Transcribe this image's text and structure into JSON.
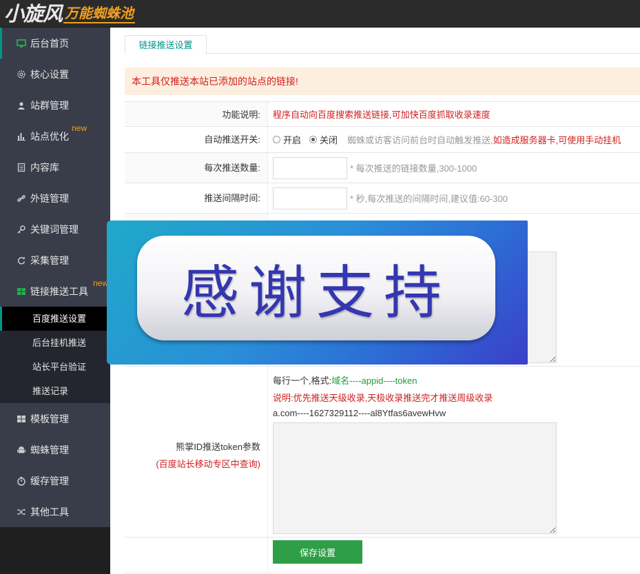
{
  "logo": {
    "main": "小旋风",
    "sub": "万能蜘蛛池"
  },
  "sidebar": {
    "items": [
      {
        "label": "后台首页",
        "icon": "monitor-icon"
      },
      {
        "label": "核心设置",
        "icon": "gear-icon"
      },
      {
        "label": "站群管理",
        "icon": "user-icon"
      },
      {
        "label": "站点优化",
        "icon": "bar-chart-icon",
        "badge": "new"
      },
      {
        "label": "内容库",
        "icon": "document-icon"
      },
      {
        "label": "外链管理",
        "icon": "link-icon"
      },
      {
        "label": "关键词管理",
        "icon": "key-icon"
      },
      {
        "label": "采集管理",
        "icon": "refresh-icon"
      },
      {
        "label": "链接推送工具",
        "icon": "windows-icon",
        "badge": "new"
      }
    ],
    "sub_items": [
      "百度推送设置",
      "后台挂机推送",
      "站长平台验证",
      "推送记录"
    ],
    "items_after": [
      {
        "label": "模板管理",
        "icon": "windows-icon"
      },
      {
        "label": "蜘蛛管理",
        "icon": "android-icon"
      },
      {
        "label": "缓存管理",
        "icon": "timer-icon"
      },
      {
        "label": "其他工具",
        "icon": "shuffle-icon"
      }
    ]
  },
  "tab": {
    "label": "链接推送设置"
  },
  "notice": "本工具仅推送本站已添加的站点的链接!",
  "form": {
    "func_desc": {
      "label": "功能说明:",
      "text": "程序自动向百度搜索推送链接,可加快百度抓取收录速度"
    },
    "auto_push": {
      "label": "自动推送开关:",
      "on": "开启",
      "off": "关闭",
      "hint_gray": "蜘蛛或访客访问前台时自动触发推送,",
      "hint_red": "如造成服务器卡,可使用手动挂机"
    },
    "per_count": {
      "label": "每次推送数量:",
      "value": "",
      "hint": "* 每次推送的链接数量,300-1000"
    },
    "interval": {
      "label": "推送间隔时间:",
      "value": "",
      "hint": "* 秒,每次推送的间隔时间,建议值:60-300"
    },
    "token": {
      "label": "熊掌ID推送token参数",
      "label_sub": "(百度站长移动专区中查询)",
      "line1_prefix": "每行一个,格式:",
      "line1_format": "域名----appid----token",
      "line2": "说明:优先推送天级收录,天极收录推送完才推送周级收录",
      "example": "a.com----1627329112----al8Ytfas6avewHvw"
    },
    "save_label": "保存设置"
  },
  "banner": {
    "text": "感谢支持"
  }
}
